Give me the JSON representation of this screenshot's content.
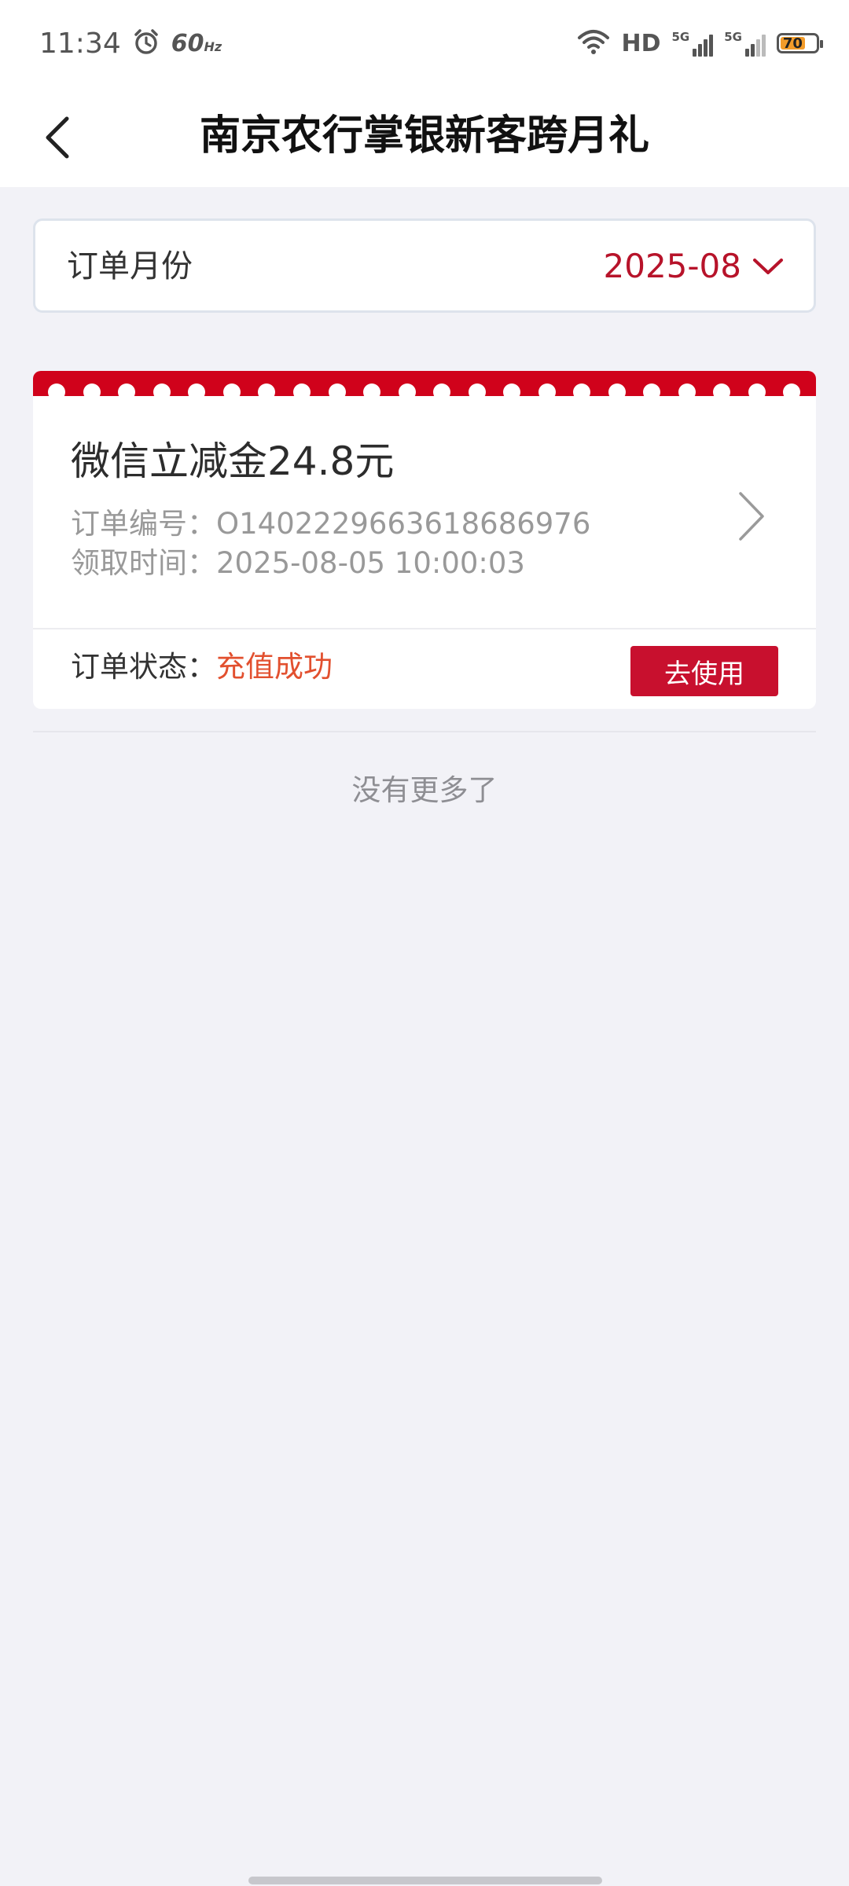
{
  "status_bar": {
    "time": "11:34",
    "refresh_rate": "60",
    "refresh_unit": "Hz",
    "network_label": "HD",
    "signal1_label": "5G",
    "signal2_label": "5G",
    "battery_percent": "70",
    "battery_level": 0.7
  },
  "header": {
    "title": "南京农行掌银新客跨月礼"
  },
  "month_filter": {
    "label": "订单月份",
    "value": "2025-08"
  },
  "order": {
    "title": "微信立减金24.8元",
    "order_no_label": "订单编号：",
    "order_no": "O1402229663618686976",
    "time_label": "领取时间：",
    "time": "2025-08-05 10:00:03",
    "status_label": "订单状态：",
    "status_value": "充值成功",
    "use_button": "去使用"
  },
  "list_end_text": "没有更多了",
  "colors": {
    "accent_red": "#d0021b",
    "button_red": "#c8102e",
    "status_orange": "#e2502f",
    "month_red": "#b7132a",
    "page_bg": "#f2f2f7"
  }
}
